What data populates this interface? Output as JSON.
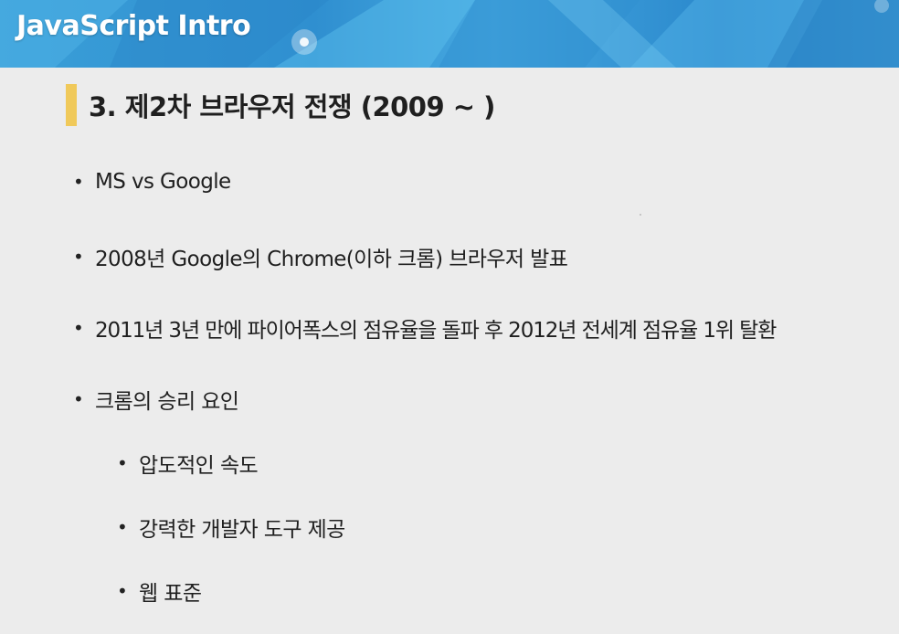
{
  "banner": {
    "title": "JavaScript Intro",
    "colors": {
      "primary": "#2f8fd0",
      "light": "#5bb8ea",
      "dark": "#1f78bf"
    }
  },
  "heading": {
    "text": "3. 제2차 브라우저 전쟁 (2009 ~ )",
    "bar_color": "#f0c95a"
  },
  "bullets": [
    {
      "level": 1,
      "text": "MS vs Google"
    },
    {
      "level": 1,
      "text": "2008년 Google의 Chrome(이하 크롬) 브라우저 발표"
    },
    {
      "level": 1,
      "text": "2011년 3년 만에 파이어폭스의 점유율을 돌파 후 2012년 전세계 점유율 1위 탈환"
    },
    {
      "level": 1,
      "text": "크롬의 승리 요인"
    },
    {
      "level": 2,
      "text": "압도적인 속도"
    },
    {
      "level": 2,
      "text": "강력한 개발자 도구 제공"
    },
    {
      "level": 2,
      "text": "웹 표준"
    }
  ],
  "bullet_symbol": "•"
}
